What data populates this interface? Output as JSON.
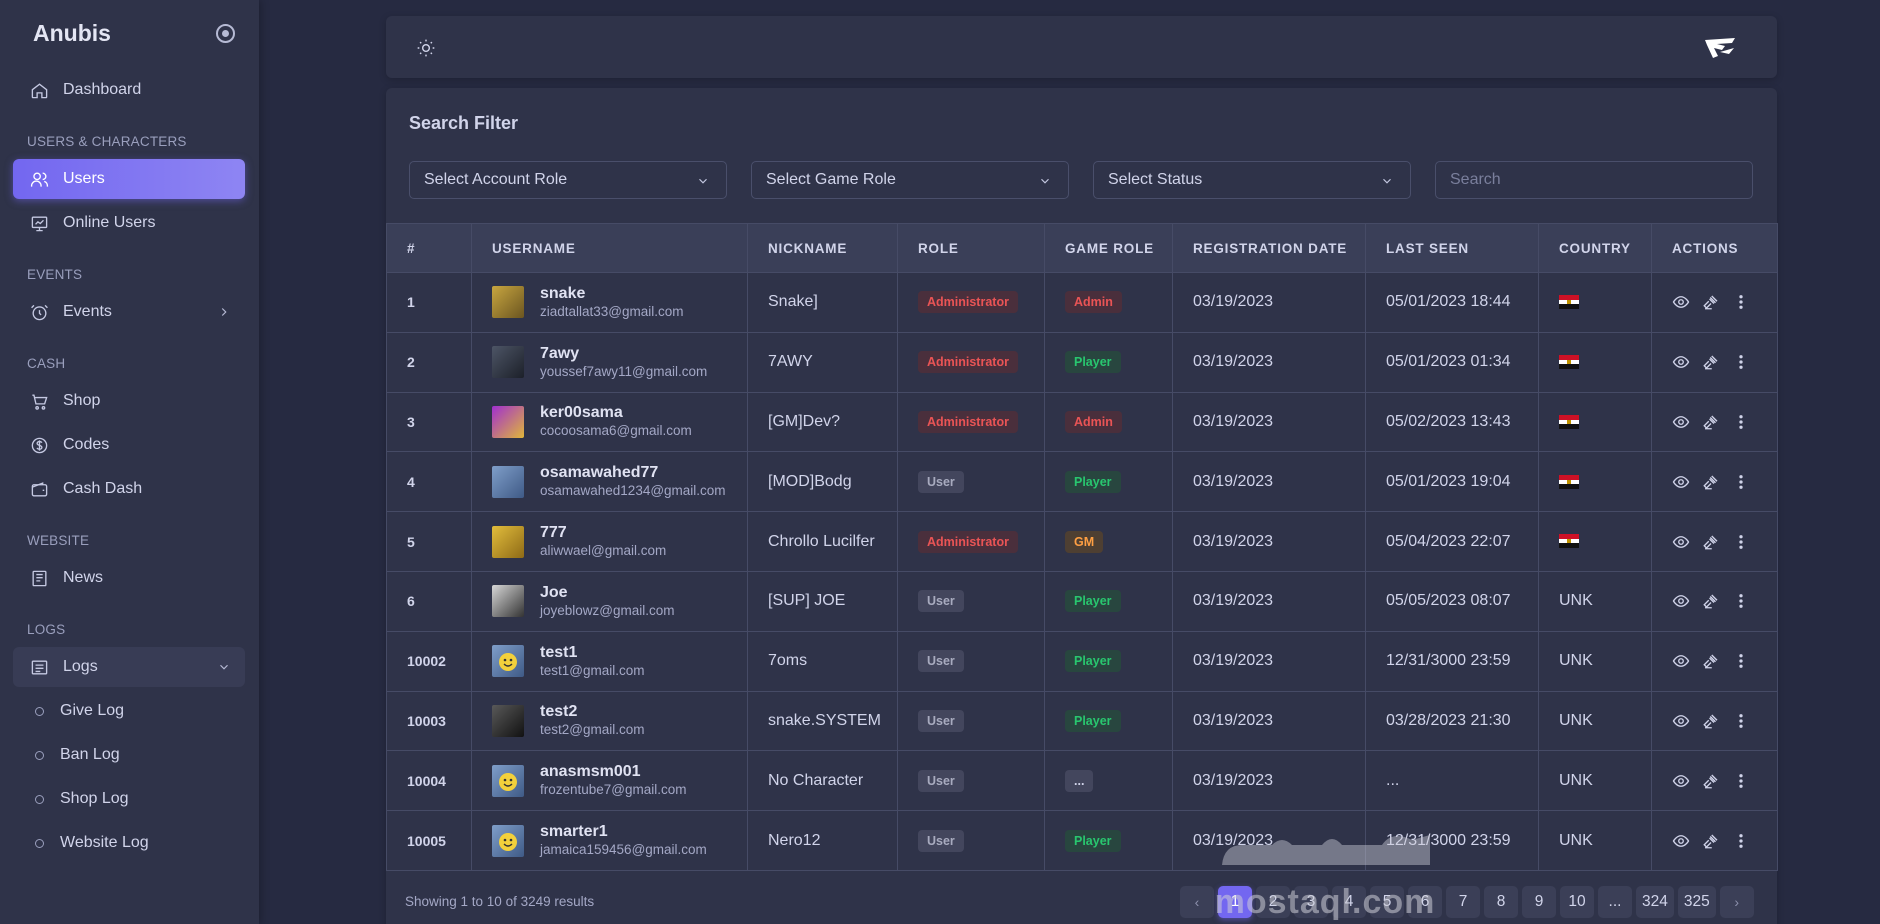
{
  "sidebar": {
    "brand": "Anubis",
    "items": {
      "dashboard": "Dashboard",
      "section_users": "USERS & CHARACTERS",
      "users": "Users",
      "online_users": "Online Users",
      "section_events": "EVENTS",
      "events": "Events",
      "section_cash": "CASH",
      "shop": "Shop",
      "codes": "Codes",
      "cash_dash": "Cash Dash",
      "section_website": "WEBSITE",
      "news": "News",
      "section_logs": "LOGS",
      "logs": "Logs",
      "give_log": "Give Log",
      "ban_log": "Ban Log",
      "shop_log": "Shop Log",
      "website_log": "Website Log"
    }
  },
  "filter": {
    "title": "Search Filter",
    "account_role": "Select Account Role",
    "game_role": "Select Game Role",
    "status": "Select Status",
    "search_placeholder": "Search"
  },
  "table": {
    "headers": [
      "#",
      "USERNAME",
      "NICKNAME",
      "ROLE",
      "GAME ROLE",
      "REGISTRATION DATE",
      "LAST SEEN",
      "COUNTRY",
      "ACTIONS"
    ],
    "rows": [
      {
        "id": "1",
        "username": "snake",
        "email": "ziadtallat33@gmail.com",
        "nickname": "Snake]",
        "role": "Administrator",
        "game_role": "Admin",
        "reg": "03/19/2023",
        "last": "05/01/2023 18:44",
        "country": "EG"
      },
      {
        "id": "2",
        "username": "7awy",
        "email": "youssef7awy11@gmail.com",
        "nickname": "7AWY",
        "role": "Administrator",
        "game_role": "Player",
        "reg": "03/19/2023",
        "last": "05/01/2023 01:34",
        "country": "EG"
      },
      {
        "id": "3",
        "username": "ker00sama",
        "email": "cocoosama6@gmail.com",
        "nickname": "[GM]Dev?",
        "role": "Administrator",
        "game_role": "Admin",
        "reg": "03/19/2023",
        "last": "05/02/2023 13:43",
        "country": "EG"
      },
      {
        "id": "4",
        "username": "osamawahed77",
        "email": "osamawahed1234@gmail.com",
        "nickname": "[MOD]Bodg",
        "role": "User",
        "game_role": "Player",
        "reg": "03/19/2023",
        "last": "05/01/2023 19:04",
        "country": "EG"
      },
      {
        "id": "5",
        "username": "777",
        "email": "aliwwael@gmail.com",
        "nickname": "Chrollo Lucilfer",
        "role": "Administrator",
        "game_role": "GM",
        "reg": "03/19/2023",
        "last": "05/04/2023 22:07",
        "country": "EG"
      },
      {
        "id": "6",
        "username": "Joe",
        "email": "joyeblowz@gmail.com",
        "nickname": "[SUP] JOE",
        "role": "User",
        "game_role": "Player",
        "reg": "03/19/2023",
        "last": "05/05/2023 08:07",
        "country": "UNK"
      },
      {
        "id": "10002",
        "username": "test1",
        "email": "test1@gmail.com",
        "nickname": "7oms",
        "role": "User",
        "game_role": "Player",
        "reg": "03/19/2023",
        "last": "12/31/3000 23:59",
        "country": "UNK"
      },
      {
        "id": "10003",
        "username": "test2",
        "email": "test2@gmail.com",
        "nickname": "snake.SYSTEM",
        "role": "User",
        "game_role": "Player",
        "reg": "03/19/2023",
        "last": "03/28/2023 21:30",
        "country": "UNK"
      },
      {
        "id": "10004",
        "username": "anasmsm001",
        "email": "frozentube7@gmail.com",
        "nickname": "No Character",
        "role": "User",
        "game_role": "...",
        "reg": "03/19/2023",
        "last": "...",
        "country": "UNK"
      },
      {
        "id": "10005",
        "username": "smarter1",
        "email": "jamaica159456@gmail.com",
        "nickname": "Nero12",
        "role": "User",
        "game_role": "Player",
        "reg": "03/19/2023",
        "last": "12/31/3000 23:59",
        "country": "UNK"
      }
    ]
  },
  "footer": {
    "showing": "Showing 1 to 10 of 3249 results",
    "pages": [
      "‹",
      "1",
      "2",
      "3",
      "4",
      "5",
      "6",
      "7",
      "8",
      "9",
      "10",
      "...",
      "324",
      "325",
      "›"
    ],
    "current_page": "1"
  },
  "watermark": {
    "latin": "mostaql.com",
    "arabic": "مستقل"
  },
  "colors": {
    "accent": "#7367f0",
    "danger": "#ea5455",
    "success": "#28c76f",
    "warning": "#ff9f43"
  }
}
